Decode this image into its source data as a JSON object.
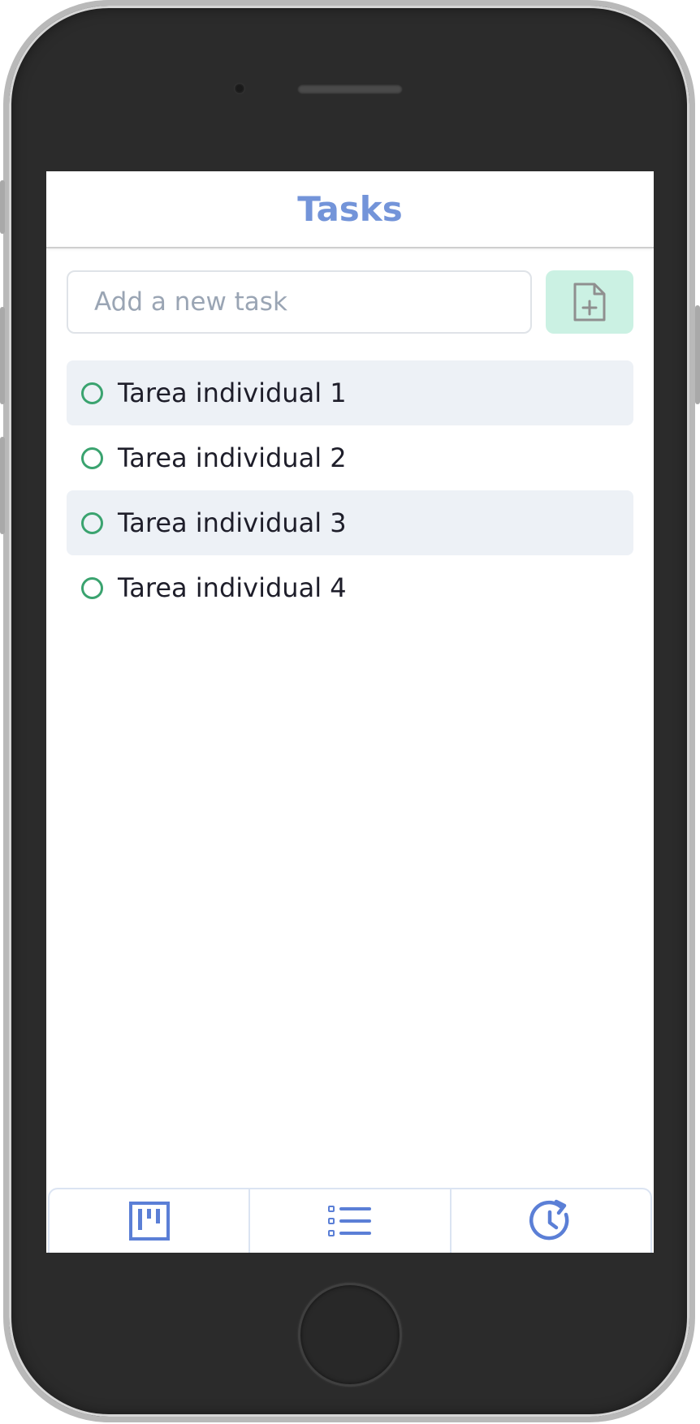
{
  "header": {
    "title": "Tasks"
  },
  "new_task": {
    "placeholder": "Add a new task",
    "value": "",
    "add_icon": "file-plus-icon"
  },
  "tasks": [
    {
      "label": "Tarea individual 1",
      "done": false,
      "shaded": true
    },
    {
      "label": "Tarea individual 2",
      "done": false,
      "shaded": false
    },
    {
      "label": "Tarea individual 3",
      "done": false,
      "shaded": true
    },
    {
      "label": "Tarea individual 4",
      "done": false,
      "shaded": false
    }
  ],
  "bottom_nav": {
    "tabs": [
      {
        "icon": "kanban-board-icon"
      },
      {
        "icon": "list-icon"
      },
      {
        "icon": "history-clock-icon"
      }
    ]
  },
  "colors": {
    "accent": "#7394d9",
    "nav_icon": "#5b7fd6",
    "add_button_bg": "#cbf1e3",
    "checkbox": "#3aa36f",
    "shaded_row": "#edf1f6"
  }
}
